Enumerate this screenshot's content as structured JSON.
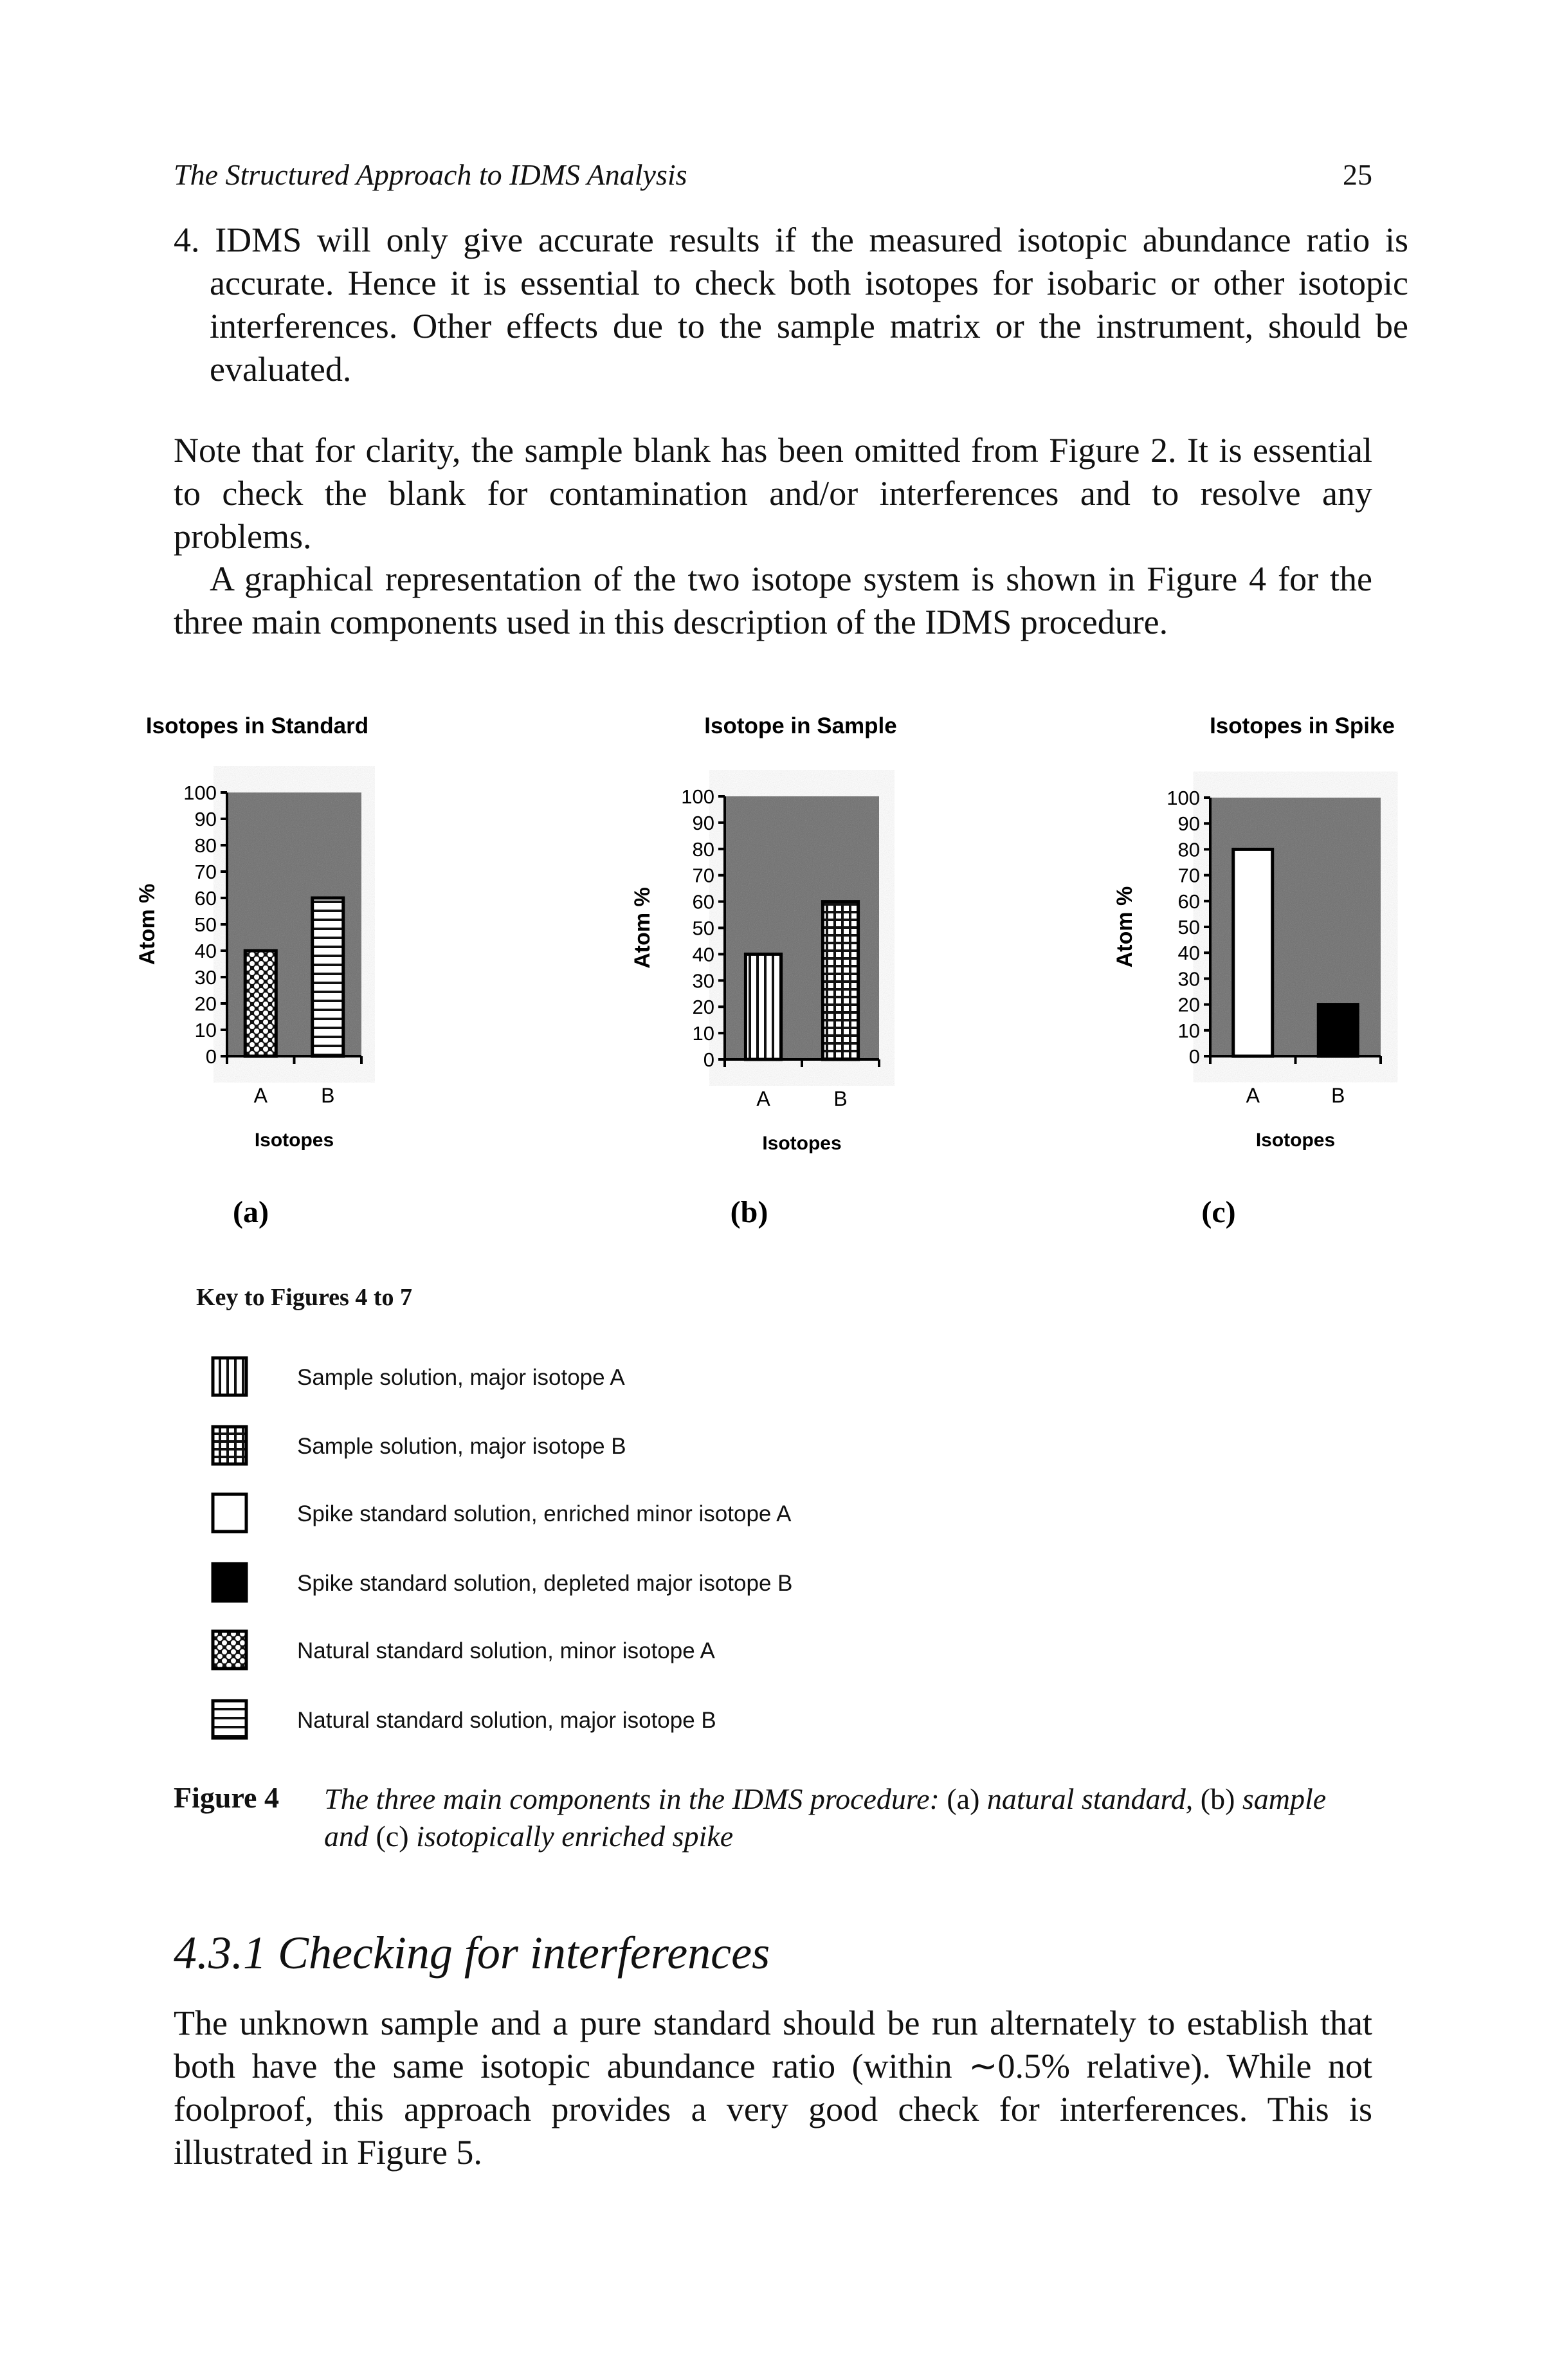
{
  "header": {
    "running_title": "The Structured Approach to IDMS Analysis",
    "page_number": "25"
  },
  "paragraphs": {
    "item4": "4. IDMS will only give accurate results if the measured isotopic abundance ratio is accurate. Hence it is essential to check both isotopes for isobaric or other isotopic interferences. Other effects due to the sample matrix or the instrument, should be evaluated.",
    "note": "Note that for clarity, the sample blank has been omitted from Figure 2. It is essential to check the blank for contamination and/or interferences and to resolve any problems.",
    "graphical": "A graphical representation of the two isotope system is shown in Figure 4 for the three main components used in this description of the IDMS procedure."
  },
  "chart_data": [
    {
      "type": "bar",
      "title": "Isotopes in Standard",
      "panel": "(a)",
      "xlabel": "Isotopes",
      "ylabel": "Atom %",
      "categories": [
        "A",
        "B"
      ],
      "values": [
        40,
        60
      ],
      "patterns": [
        "natural-minor-A",
        "natural-major-B"
      ],
      "ylim": [
        0,
        100
      ],
      "yticks": [
        0,
        10,
        20,
        30,
        40,
        50,
        60,
        70,
        80,
        90,
        100
      ],
      "grid": false
    },
    {
      "type": "bar",
      "title": "Isotope in Sample",
      "panel": "(b)",
      "xlabel": "Isotopes",
      "ylabel": "Atom %",
      "categories": [
        "A",
        "B"
      ],
      "values": [
        40,
        60
      ],
      "patterns": [
        "sample-major-A",
        "sample-major-B"
      ],
      "ylim": [
        0,
        100
      ],
      "yticks": [
        0,
        10,
        20,
        30,
        40,
        50,
        60,
        70,
        80,
        90,
        100
      ],
      "grid": false
    },
    {
      "type": "bar",
      "title": "Isotopes in Spike",
      "panel": "(c)",
      "xlabel": "Isotopes",
      "ylabel": "Atom %",
      "categories": [
        "A",
        "B"
      ],
      "values": [
        80,
        20
      ],
      "patterns": [
        "spike-minor-A",
        "spike-major-B"
      ],
      "ylim": [
        0,
        100
      ],
      "yticks": [
        0,
        10,
        20,
        30,
        40,
        50,
        60,
        70,
        80,
        90,
        100
      ],
      "grid": false
    }
  ],
  "key": {
    "title": "Key to Figures 4 to 7",
    "items": [
      {
        "pattern": "sample-major-A",
        "label": "Sample solution, major isotope A"
      },
      {
        "pattern": "sample-major-B",
        "label": "Sample solution, major isotope B"
      },
      {
        "pattern": "spike-minor-A",
        "label": "Spike standard solution, enriched minor isotope A"
      },
      {
        "pattern": "spike-major-B",
        "label": "Spike standard solution, depleted major isotope B"
      },
      {
        "pattern": "natural-minor-A",
        "label": "Natural standard solution, minor isotope A"
      },
      {
        "pattern": "natural-major-B",
        "label": "Natural standard solution, major isotope B"
      }
    ]
  },
  "caption": {
    "label": "Figure 4",
    "t1": "The three main components in the IDMS procedure: ",
    "a": "(a)",
    "t2": " natural standard, ",
    "b": "(b)",
    "t3": " sample and ",
    "c": "(c)",
    "t4": " isotopically enriched spike"
  },
  "section": {
    "heading": "4.3.1 Checking for interferences",
    "body": "The unknown sample and a pure standard should be run alternately to establish that both have the same isotopic abundance ratio (within ∼0.5% relative). While not foolproof, this approach provides a very good check for interferences. This is illustrated in Figure 5."
  },
  "colors": {
    "plot_background": "#6e6e6e",
    "ink": "#111111",
    "paper": "#ffffff"
  }
}
